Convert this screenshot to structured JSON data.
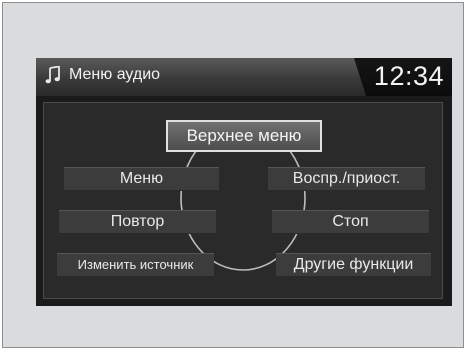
{
  "header": {
    "icon": "music-note-icon",
    "title": "Меню аудио",
    "clock": "12:34"
  },
  "menu": {
    "top_menu": "Верхнее меню",
    "menu": "Меню",
    "play_pause": "Воспр./приост.",
    "repeat": "Повтор",
    "stop": "Стоп",
    "change_source": "Изменить источник",
    "other_functions": "Другие функции"
  },
  "colors": {
    "screen_background": "#1b1b1b",
    "frame_background": "#dadbdd",
    "text": "#e9e9e9"
  }
}
